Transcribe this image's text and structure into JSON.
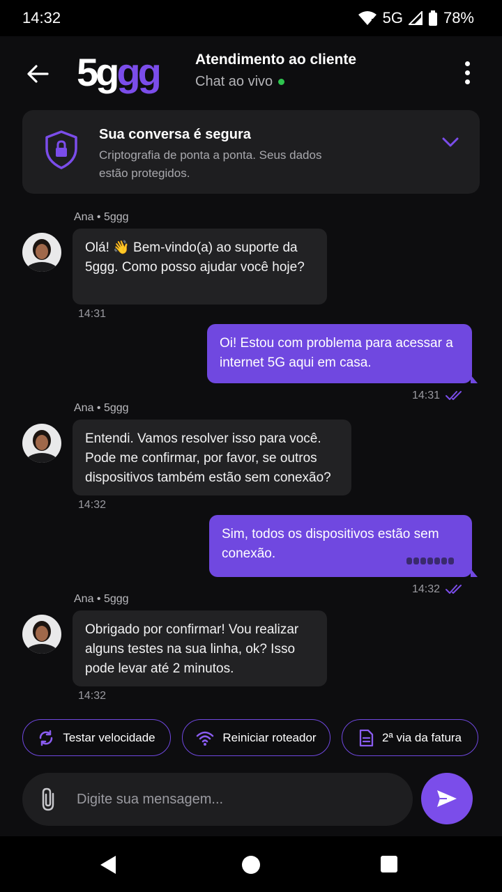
{
  "status_bar": {
    "time": "14:32",
    "network": "5G",
    "battery": "78%"
  },
  "header": {
    "logo_part1": "5g",
    "logo_part2": "gg",
    "title": "Atendimento ao cliente",
    "subtitle": "Chat ao vivo",
    "online_color": "#2fc44f"
  },
  "secure_banner": {
    "title": "Sua conversa é segura",
    "text": "Criptografia de ponta a ponta. Seus dados estão protegidos."
  },
  "messages": [
    {
      "from": "agent",
      "sender": "Ana • 5ggg",
      "text": "Olá! 👋 Bem-vindo(a) ao suporte da 5ggg. Como posso ajudar você hoje?",
      "time": "14:31"
    },
    {
      "from": "user",
      "text": "Oi! Estou com problema para acessar a internet 5G aqui em casa.",
      "time": "14:31",
      "status": "read"
    },
    {
      "from": "agent",
      "sender": "Ana • 5ggg",
      "text": "Entendi. Vamos resolver isso para você. Pode me confirmar, por favor, se outros dispositivos também estão sem conexão?",
      "time": "14:32"
    },
    {
      "from": "user",
      "text": "Sim, todos os dispositivos estão sem conexão.",
      "time": "14:32",
      "status": "read"
    },
    {
      "from": "agent",
      "sender": "Ana • 5ggg",
      "text": "Obrigado por confirmar! Vou realizar alguns testes na sua linha, ok? Isso pode levar até 2 minutos.",
      "time": "14:32"
    }
  ],
  "quick_replies": [
    {
      "label": "Testar velocidade",
      "icon": "refresh-icon"
    },
    {
      "label": "Reiniciar roteador",
      "icon": "wifi-icon"
    },
    {
      "label": "2ª via da fatura",
      "icon": "document-icon"
    }
  ],
  "composer": {
    "placeholder": "Digite sua mensagem..."
  },
  "colors": {
    "accent": "#7048e0",
    "background": "#0d0d0f",
    "bubble_in": "#222224"
  }
}
